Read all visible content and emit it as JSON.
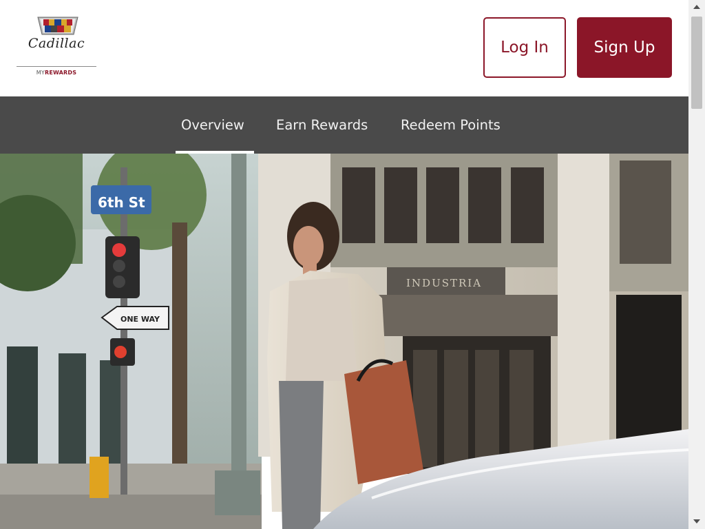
{
  "brand": {
    "wordmark": "Cadillac",
    "tagline_prefix": "MY",
    "tagline_accent": "REWARDS",
    "accent_color": "#8b1628"
  },
  "header": {
    "login_label": "Log In",
    "signup_label": "Sign Up"
  },
  "nav": {
    "tabs": [
      {
        "label": "Overview",
        "active": true
      },
      {
        "label": "Earn Rewards",
        "active": false
      },
      {
        "label": "Redeem Points",
        "active": false
      }
    ],
    "background": "#4a4a4a"
  },
  "hero": {
    "street_sign": "6th St",
    "one_way_sign": "ONE WAY",
    "building_sign": "INDUSTRIA"
  }
}
